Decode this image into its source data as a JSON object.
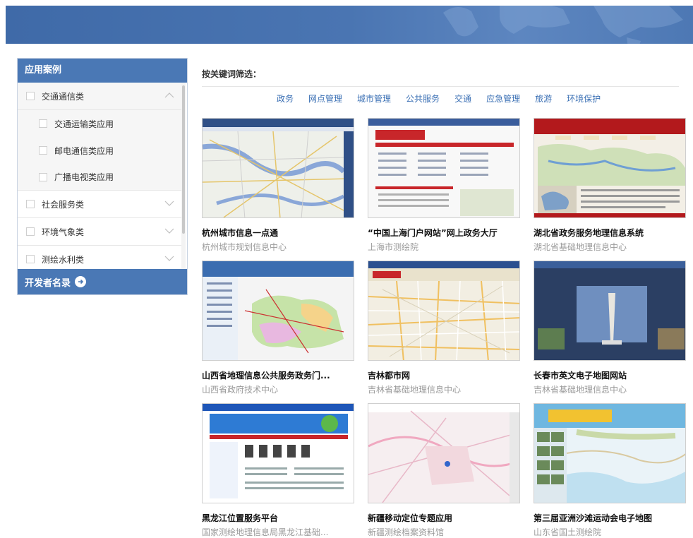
{
  "sidebar": {
    "title": "应用案例",
    "items": [
      {
        "label": "交通通信类",
        "expanded": true,
        "icon": "chevron-up-icon"
      },
      {
        "label": "交通运输类应用",
        "sub": true
      },
      {
        "label": "邮电通信类应用",
        "sub": true
      },
      {
        "label": "广播电视类应用",
        "sub": true
      },
      {
        "label": "社会服务类",
        "icon": "chevron-down-icon"
      },
      {
        "label": "环境气象类",
        "icon": "chevron-down-icon"
      },
      {
        "label": "测绘水利类",
        "icon": "chevron-down-icon"
      }
    ],
    "footer": "开发者名录",
    "footer_icon": "arrow-right-circle-icon"
  },
  "filter": {
    "label": "按关键词筛选：",
    "tags": [
      "政务",
      "网点管理",
      "城市管理",
      "公共服务",
      "交通",
      "应急管理",
      "旅游",
      "环境保护"
    ]
  },
  "cards": [
    {
      "title": "杭州城市信息一点通",
      "org": "杭州城市规划信息中心",
      "thumb": "map-app-screenshot"
    },
    {
      "title": "“中国上海门户网站”网上政务大厅",
      "org": "上海市测绘院",
      "thumb": "portal-screenshot"
    },
    {
      "title": "湖北省政务服务地理信息系统",
      "org": "湖北省基础地理信息中心",
      "thumb": "province-map-screenshot"
    },
    {
      "title": "山西省地理信息公共服务政务门...",
      "org": "山西省政府技术中心",
      "thumb": "gis-portal-screenshot"
    },
    {
      "title": "吉林都市网",
      "org": "吉林省基础地理信息中心",
      "thumb": "city-map-screenshot"
    },
    {
      "title": "长春市英文电子地图网站",
      "org": "吉林省基础地理信息中心",
      "thumb": "english-map-screenshot"
    },
    {
      "title": "黑龙江位置服务平台",
      "org": "国家测绘地理信息局黑龙江基础...",
      "thumb": "lbs-portal-screenshot"
    },
    {
      "title": "新疆移动定位专题应用",
      "org": "新疆测绘档案资料馆",
      "thumb": "mobile-location-map-screenshot"
    },
    {
      "title": "第三届亚洲沙滩运动会电子地图",
      "org": "山东省国土测绘院",
      "thumb": "games-map-screenshot"
    }
  ],
  "colors": {
    "primary": "#4a78b5",
    "link": "#3a6fb4"
  }
}
